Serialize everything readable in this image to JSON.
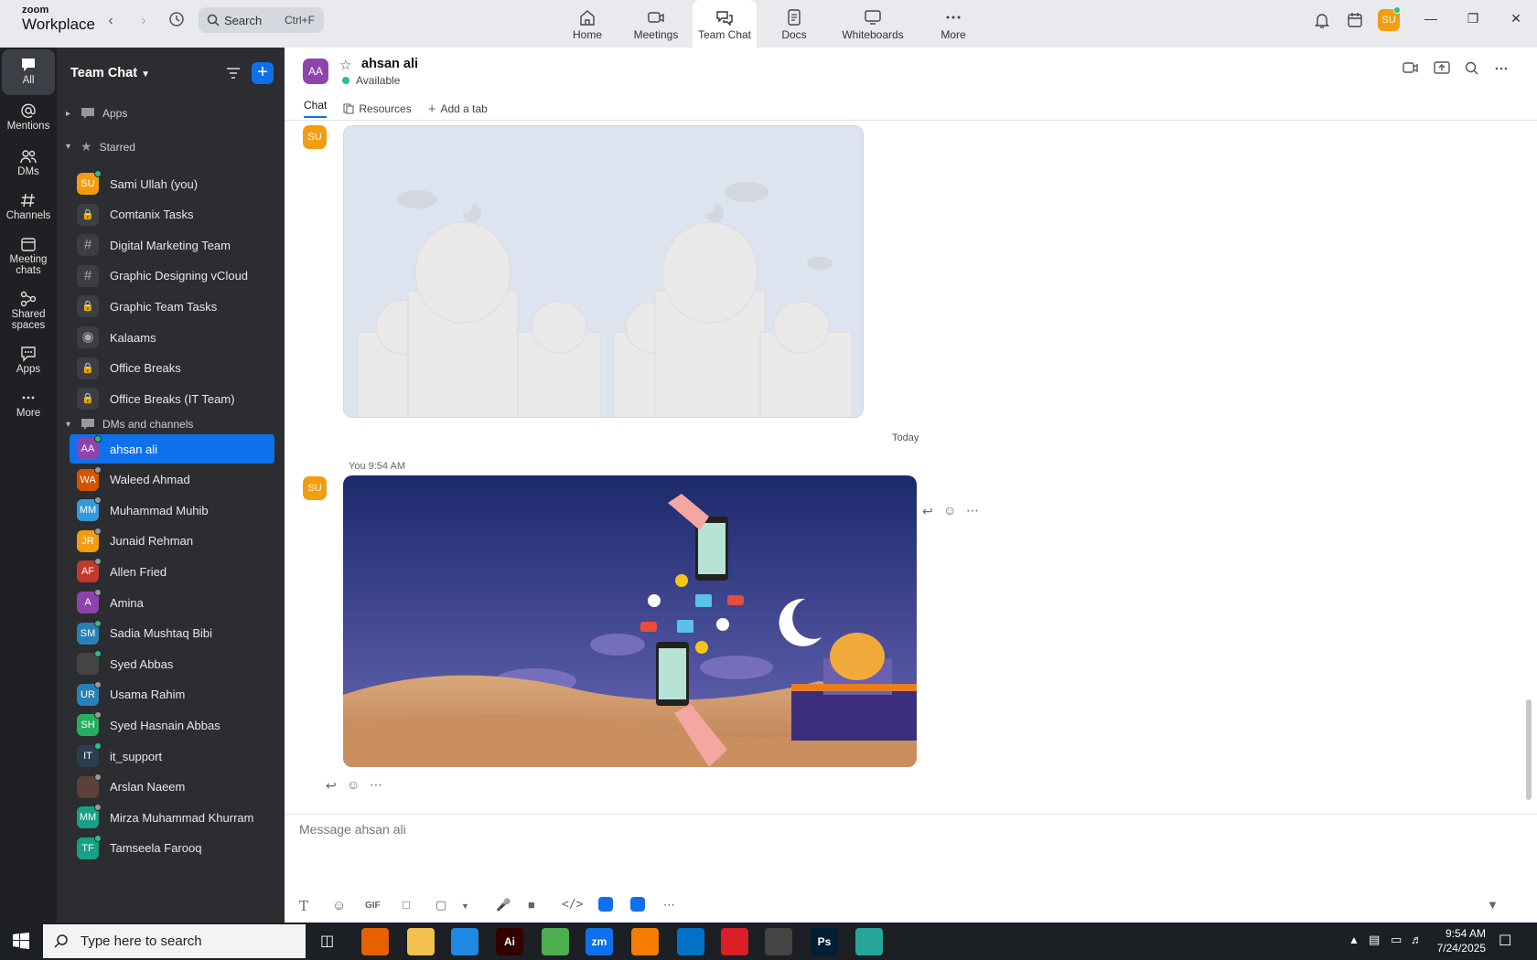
{
  "brand": {
    "line1": "zoom",
    "line2": "Workplace"
  },
  "search": {
    "label": "Search",
    "shortcut": "Ctrl+F"
  },
  "tabs": [
    {
      "label": "Home",
      "icon": "home-icon"
    },
    {
      "label": "Meetings",
      "icon": "video-camera-icon"
    },
    {
      "label": "Team Chat",
      "icon": "chat-bubbles-icon"
    },
    {
      "label": "Docs",
      "icon": "document-icon"
    },
    {
      "label": "Whiteboards",
      "icon": "whiteboard-icon"
    },
    {
      "label": "More",
      "icon": "more-dots-icon"
    }
  ],
  "user_initials": "SU",
  "rail": [
    {
      "label": "All",
      "icon": "chat-bubble-icon"
    },
    {
      "label": "Mentions",
      "icon": "at-sign-icon"
    },
    {
      "label": "DMs",
      "icon": "people-icon"
    },
    {
      "label": "Channels",
      "icon": "hash-icon"
    },
    {
      "label": "Meeting chats",
      "icon": "calendar-icon"
    },
    {
      "label": "Shared spaces",
      "icon": "share-nodes-icon"
    },
    {
      "label": "Apps",
      "icon": "apps-bubble-icon"
    },
    {
      "label": "More",
      "icon": "more-dots-icon"
    }
  ],
  "sidebar": {
    "title": "Team Chat",
    "sections": {
      "apps": "Apps",
      "starred": "Starred",
      "dms": "DMs and channels"
    },
    "starred": [
      {
        "label": "Sami Ullah (you)",
        "type": "avatar",
        "initials": "SU",
        "color": "#f39c12",
        "status": "on"
      },
      {
        "label": "Comtanix Tasks",
        "type": "lock"
      },
      {
        "label": "Digital Marketing Team",
        "type": "hash"
      },
      {
        "label": "Graphic Designing vCloud",
        "type": "hash"
      },
      {
        "label": "Graphic Team Tasks",
        "type": "lock"
      },
      {
        "label": "Kalaams",
        "type": "group"
      },
      {
        "label": "Office Breaks",
        "type": "lock"
      },
      {
        "label": "Office Breaks (IT Team)",
        "type": "lock"
      }
    ],
    "dms": [
      {
        "label": "ahsan ali",
        "initials": "AA",
        "color": "#8e44ad",
        "status": "on"
      },
      {
        "label": "Waleed Ahmad",
        "initials": "WA",
        "color": "#d35400",
        "status": "off"
      },
      {
        "label": "Muhammad Muhib",
        "initials": "MM",
        "color": "#3498db",
        "status": "off"
      },
      {
        "label": "Junaid Rehman",
        "initials": "JR",
        "color": "#f39c12",
        "status": "off"
      },
      {
        "label": "Allen Fried",
        "initials": "AF",
        "color": "#c0392b",
        "status": "off"
      },
      {
        "label": "Amina",
        "initials": "A",
        "color": "#8e44ad",
        "status": "off"
      },
      {
        "label": "Sadia Mushtaq Bibi",
        "initials": "SM",
        "color": "#2980b9",
        "status": "on"
      },
      {
        "label": "Syed Abbas",
        "initials": "",
        "color": "#444444",
        "status": "on"
      },
      {
        "label": "Usama Rahim",
        "initials": "UR",
        "color": "#2980b9",
        "status": "off"
      },
      {
        "label": "Syed Hasnain Abbas",
        "initials": "SH",
        "color": "#27ae60",
        "status": "off"
      },
      {
        "label": "it_support",
        "initials": "IT",
        "color": "#2c3e50",
        "status": "on"
      },
      {
        "label": "Arslan Naeem",
        "initials": "",
        "color": "#5d4037",
        "status": "off"
      },
      {
        "label": "Mirza Muhammad Khurram",
        "initials": "MM",
        "color": "#16a085",
        "status": "off"
      },
      {
        "label": "Tamseela Farooq",
        "initials": "TF",
        "color": "#16a085",
        "status": "on"
      }
    ]
  },
  "chat": {
    "name": "ahsan ali",
    "initials": "AA",
    "status": "Available",
    "tabs": {
      "chat": "Chat",
      "resources": "Resources",
      "add": "Add a tab"
    },
    "divider": "Today",
    "sender": "You 9:54 AM",
    "composer_placeholder": "Message ahsan ali",
    "gif_label": "GIF"
  },
  "taskbar": {
    "search_placeholder": "Type here to search",
    "time": "9:54 AM",
    "date": "7/24/2025",
    "apps": [
      {
        "name": "firefox",
        "label": "",
        "color": "#e66000"
      },
      {
        "name": "file-explorer",
        "label": "",
        "color": "#f2c14e"
      },
      {
        "name": "vscode",
        "label": "",
        "color": "#1e88e5"
      },
      {
        "name": "illustrator",
        "label": "Ai",
        "color": "#330000"
      },
      {
        "name": "chrome",
        "label": "",
        "color": "#4caf50"
      },
      {
        "name": "zoom",
        "label": "zm",
        "color": "#0e71eb"
      },
      {
        "name": "xampp",
        "label": "",
        "color": "#f57c00"
      },
      {
        "name": "outlook",
        "label": "",
        "color": "#0072c6"
      },
      {
        "name": "creative-cloud",
        "label": "",
        "color": "#da1f26"
      },
      {
        "name": "pen-tool",
        "label": "",
        "color": "#444444"
      },
      {
        "name": "photoshop",
        "label": "Ps",
        "color": "#001e36"
      },
      {
        "name": "app-gem",
        "label": "",
        "color": "#26a69a"
      }
    ]
  }
}
